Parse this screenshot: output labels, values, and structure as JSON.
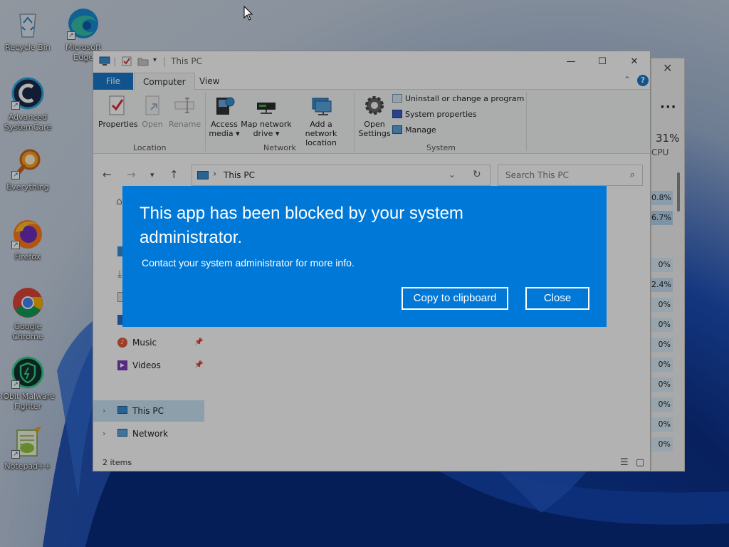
{
  "desktop": {
    "icons": [
      {
        "label": "Recycle Bin",
        "icon": "recycle-bin-icon"
      },
      {
        "label": "Microsoft Edge",
        "icon": "edge-icon"
      },
      {
        "label": "Advanced SystemCare",
        "icon": "advanced-systemcare-icon"
      },
      {
        "label": "Everything",
        "icon": "everything-search-icon"
      },
      {
        "label": "Firefox",
        "icon": "firefox-icon"
      },
      {
        "label": "Google Chrome",
        "icon": "chrome-icon"
      },
      {
        "label": "IObit Malware Fighter",
        "icon": "iobit-malware-fighter-icon"
      },
      {
        "label": "Notepad++",
        "icon": "notepad-plus-plus-icon"
      }
    ]
  },
  "taskmgr": {
    "cpu_pct": "31%",
    "cpu_label": "CPU",
    "values": [
      "0.8%",
      "6.7%",
      "0%",
      "2.4%",
      "0%",
      "0%",
      "0%",
      "0%",
      "0%",
      "0%",
      "0%",
      "0%"
    ]
  },
  "explorer": {
    "title": "This PC",
    "tabs": {
      "file": "File",
      "computer": "Computer",
      "view": "View"
    },
    "ribbon": {
      "properties": "Properties",
      "open": "Open",
      "rename": "Rename",
      "access_media_1": "Access",
      "access_media_2": "media",
      "map_drive_1": "Map network",
      "map_drive_2": "drive",
      "add_location_1": "Add a network",
      "add_location_2": "location",
      "open_settings_1": "Open",
      "open_settings_2": "Settings",
      "uninstall": "Uninstall or change a program",
      "system_properties": "System properties",
      "manage": "Manage",
      "group_location": "Location",
      "group_network": "Network",
      "group_system": "System"
    },
    "address": {
      "path": "This PC"
    },
    "search": {
      "placeholder": "Search This PC"
    },
    "nav": {
      "music": "Music",
      "videos": "Videos",
      "this_pc": "This PC",
      "network": "Network"
    },
    "status": {
      "count": "2 items"
    }
  },
  "dialog": {
    "heading": "This app has been blocked by your system administrator.",
    "message": "Contact your system administrator for more info.",
    "copy_button": "Copy to clipboard",
    "close_button": "Close",
    "background": "#0078d7"
  }
}
